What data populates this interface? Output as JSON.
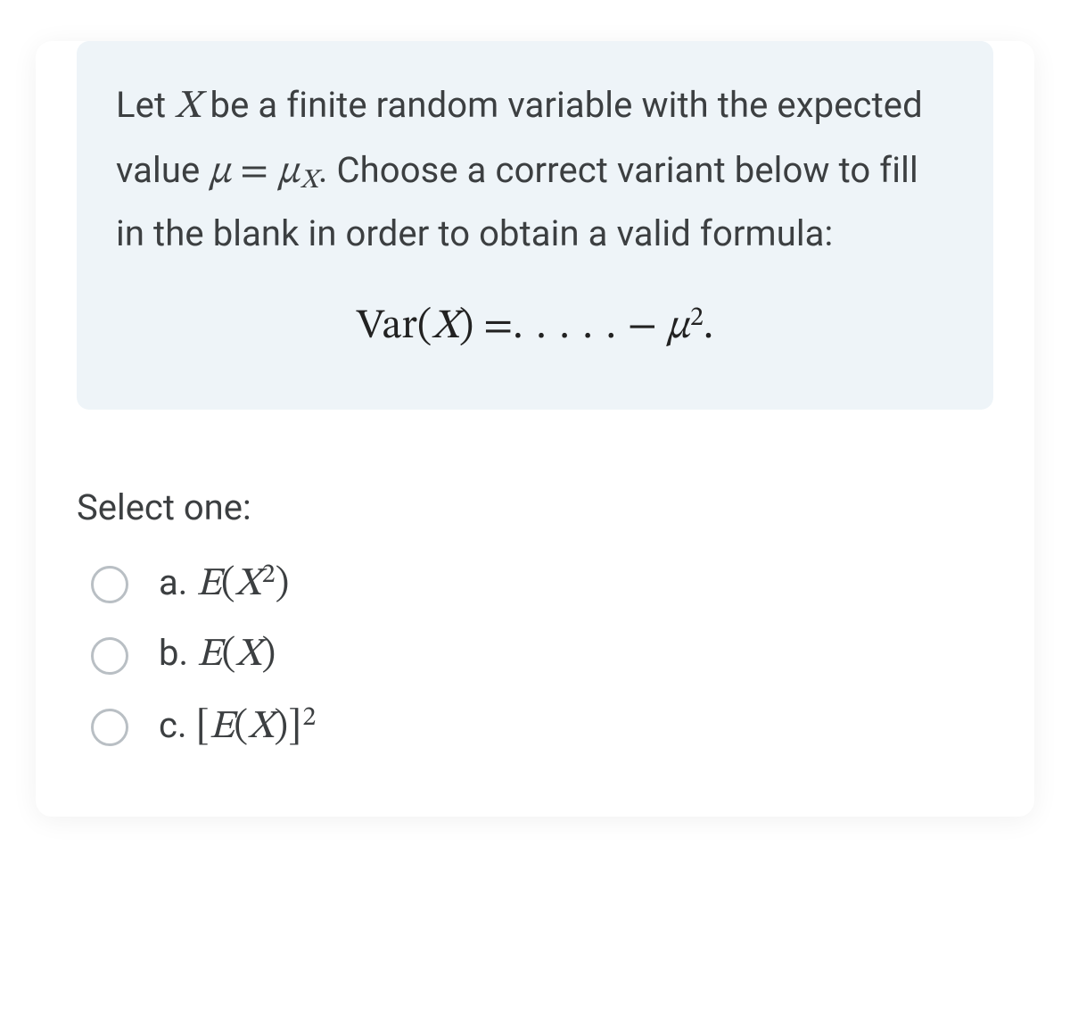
{
  "question": {
    "p1a": "Let ",
    "var_X": "X",
    "p1b": " be a finite random variable with the expected value ",
    "mu": "μ",
    "eq": " = ",
    "mu2": "μ",
    "sub_X": "X",
    "p1c": ". Choose a correct variant below to fill in the blank in order to obtain a valid formula:",
    "formula": {
      "Var": "Var",
      "open": "(",
      "X": "X",
      "close": ")",
      "eq": " =",
      "dots": ". . . . .",
      "minus": " − ",
      "mu": "μ",
      "sq": "2",
      "period": "."
    }
  },
  "select_label": "Select one:",
  "options": [
    {
      "letter": "a.",
      "E": "E",
      "open": "(",
      "X": "X",
      "sq": "2",
      "close": ")"
    },
    {
      "letter": "b.",
      "E": "E",
      "open": "(",
      "X": "X",
      "close": ")"
    },
    {
      "letter": "c.",
      "lb": "[",
      "E": "E",
      "open": "(",
      "X": "X",
      "close": ")",
      "rb": "]",
      "sq": "2"
    }
  ]
}
